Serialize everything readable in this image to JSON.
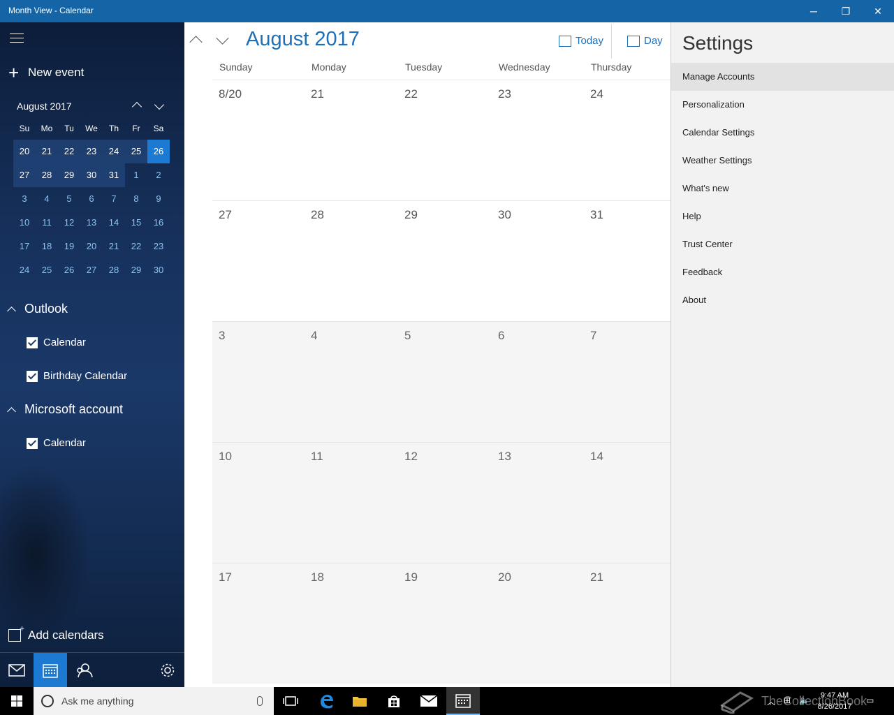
{
  "window": {
    "title": "Month View - Calendar",
    "minimize": "─",
    "maximize": "❐",
    "close": "✕"
  },
  "sidebar": {
    "new_event": "New event",
    "mini_calendar": {
      "month_label": "August 2017",
      "weekdays": [
        "Su",
        "Mo",
        "Tu",
        "We",
        "Th",
        "Fr",
        "Sa"
      ],
      "days": [
        [
          "20",
          "21",
          "22",
          "23",
          "24",
          "25",
          "26"
        ],
        [
          "27",
          "28",
          "29",
          "30",
          "31",
          "1",
          "2"
        ],
        [
          "3",
          "4",
          "5",
          "6",
          "7",
          "8",
          "9"
        ],
        [
          "10",
          "11",
          "12",
          "13",
          "14",
          "15",
          "16"
        ],
        [
          "17",
          "18",
          "19",
          "20",
          "21",
          "22",
          "23"
        ],
        [
          "24",
          "25",
          "26",
          "27",
          "28",
          "29",
          "30"
        ]
      ],
      "selected_day": "26"
    },
    "groups": [
      {
        "name": "Outlook",
        "calendars": [
          "Calendar",
          "Birthday Calendar"
        ]
      },
      {
        "name": "Microsoft account",
        "calendars": [
          "Calendar"
        ]
      }
    ],
    "add_calendars": "Add calendars"
  },
  "main": {
    "month_title": "August 2017",
    "today_label": "Today",
    "day_label": "Day",
    "weekdays": [
      "Sunday",
      "Monday",
      "Tuesday",
      "Wednesday",
      "Thursday"
    ],
    "weeks": [
      [
        "8/20",
        "21",
        "22",
        "23",
        "24"
      ],
      [
        "27",
        "28",
        "29",
        "30",
        "31"
      ],
      [
        "3",
        "4",
        "5",
        "6",
        "7"
      ],
      [
        "10",
        "11",
        "12",
        "13",
        "14"
      ],
      [
        "17",
        "18",
        "19",
        "20",
        "21"
      ]
    ]
  },
  "settings": {
    "title": "Settings",
    "items": [
      "Manage Accounts",
      "Personalization",
      "Calendar Settings",
      "Weather Settings",
      "What's new",
      "Help",
      "Trust Center",
      "Feedback",
      "About"
    ]
  },
  "taskbar": {
    "search_placeholder": "Ask me anything",
    "time": "9:47 AM",
    "date": "8/26/2017",
    "watermark": "TheCollectionBook"
  },
  "colors": {
    "accent": "#1565a6",
    "highlight": "#1c7ad2",
    "link": "#1f6fb8"
  }
}
